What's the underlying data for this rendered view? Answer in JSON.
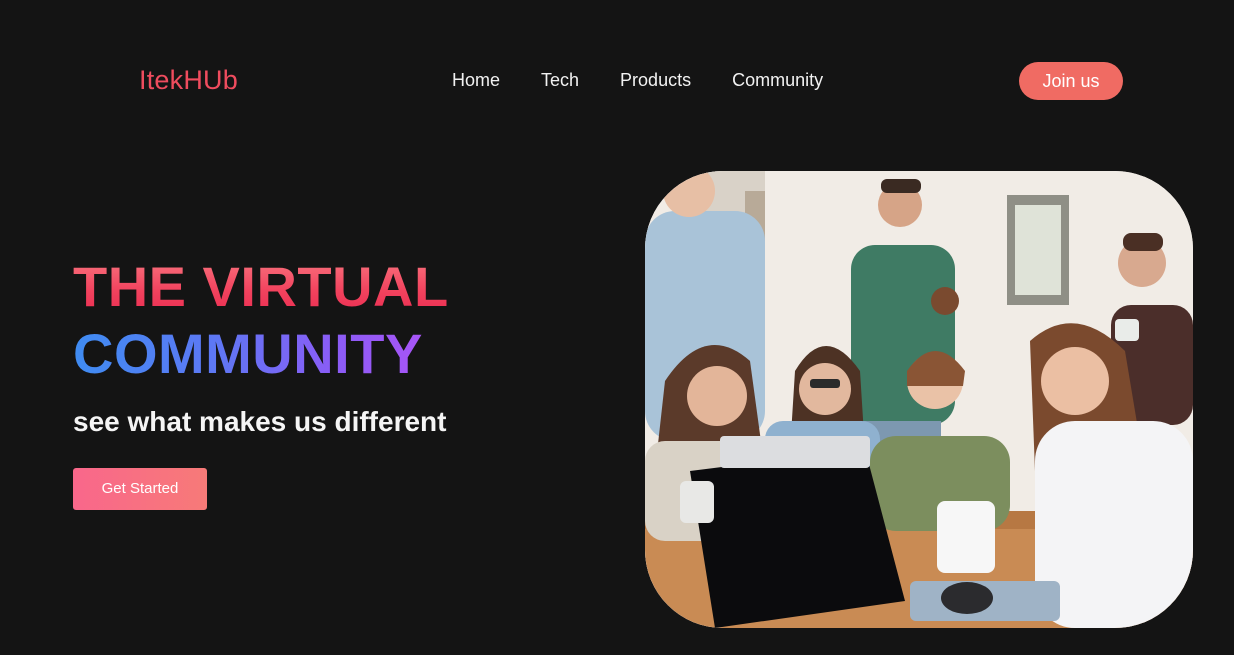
{
  "header": {
    "logo": "ItekHUb",
    "nav": [
      "Home",
      "Tech",
      "Products",
      "Community"
    ],
    "join_label": "Join us"
  },
  "hero": {
    "line1": "THE VIRTUAL",
    "line2": "COMMUNITY",
    "tagline": "see what makes us different",
    "cta_label": "Get Started"
  },
  "photo": {
    "icon": "group-photo"
  },
  "colors": {
    "background": "#141414",
    "accent": "#f06b63",
    "logo": "#ef4c5e",
    "headline_red": "#f2435e",
    "headline_blue": "#3f8cf2",
    "headline_purple": "#a855f7"
  }
}
